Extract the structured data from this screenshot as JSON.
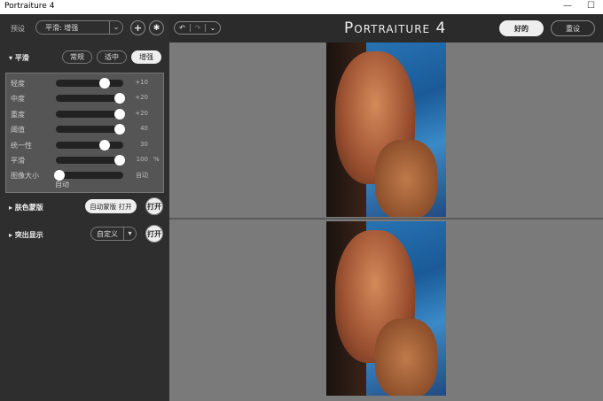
{
  "window": {
    "title": "Portraiture 4"
  },
  "header": {
    "app_title": "Portraiture 4",
    "ok_label": "好的",
    "reset_label": "重设"
  },
  "presets": {
    "label": "预设",
    "value": "平滑: 增强"
  },
  "smoothing": {
    "title": "平滑",
    "modes": [
      "常规",
      "适中",
      "增强"
    ],
    "active_mode": "增强",
    "sliders": [
      {
        "label": "轻度",
        "value": "+10",
        "level": 0.75
      },
      {
        "label": "中度",
        "value": "+20",
        "level": 1.0
      },
      {
        "label": "重度",
        "value": "+20",
        "level": 1.0
      },
      {
        "label": "阈值",
        "value": "40",
        "level": 1.0
      },
      {
        "label": "统一性",
        "value": "30",
        "level": 0.75
      },
      {
        "label": "平滑",
        "value": "100",
        "unit": "%",
        "level": 1.0
      },
      {
        "label": "图像大小",
        "value": "自动",
        "level": 0.0
      }
    ],
    "size_below": "自动"
  },
  "skin_mask": {
    "title": "肤色蒙版",
    "auto_label": "自动蒙版 打开",
    "toggle_label": "打开"
  },
  "enhance": {
    "title": "突出显示",
    "select_value": "自定义",
    "toggle_label": "打开"
  }
}
